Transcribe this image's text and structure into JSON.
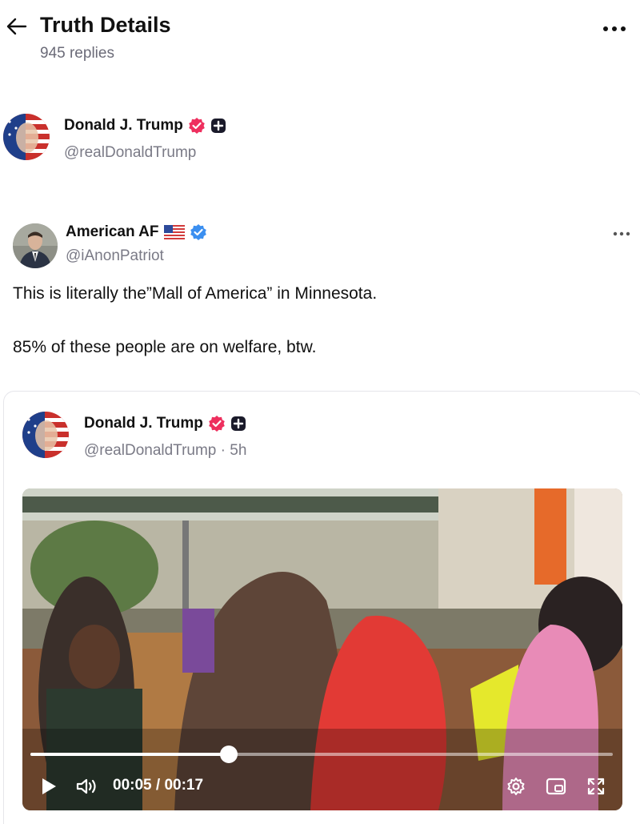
{
  "header": {
    "title": "Truth Details",
    "replies": "945 replies"
  },
  "author": {
    "name": "Donald J. Trump",
    "handle": "@realDonaldTrump"
  },
  "post": {
    "name": "American AF",
    "handle": "@iAnonPatriot",
    "lines": [
      "This is literally the”Mall of America” in Minnesota.",
      "85% of these people are on welfare, btw."
    ]
  },
  "quote": {
    "name": "Donald J. Trump",
    "handle": "@realDonaldTrump",
    "time": "5h"
  },
  "video": {
    "current_time": "00:05",
    "duration": "00:17",
    "progress": 0.34
  },
  "colors": {
    "verified_trump": "#ee2f5e",
    "verified_blue": "#3b8ff0"
  },
  "icons": {
    "back": "back-arrow-icon",
    "more": "more-icon",
    "play": "play-icon",
    "volume": "volume-icon",
    "settings": "settings-icon",
    "pip": "picture-in-picture-icon",
    "fullscreen": "fullscreen-icon"
  }
}
